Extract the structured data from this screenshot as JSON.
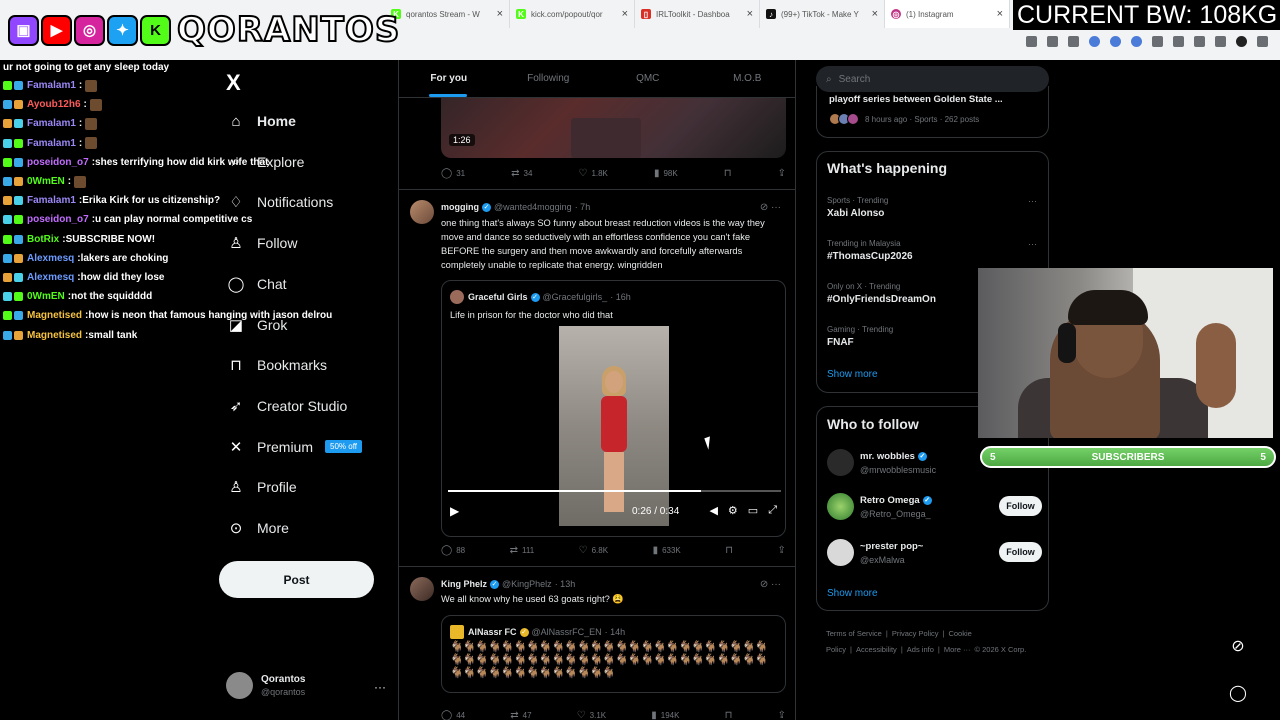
{
  "browser": {
    "tabs": [
      {
        "title": "qorantos Stream - W",
        "icon": "kick-icon",
        "color": "#53fc18"
      },
      {
        "title": "kick.com/popout/qor",
        "icon": "kick-icon",
        "color": "#53fc18"
      },
      {
        "title": "IRLToolkit - Dashboa",
        "icon": "irltoolkit-icon",
        "color": "#d93025"
      },
      {
        "title": "(99+) TikTok - Make Y",
        "icon": "tiktok-icon",
        "color": "#111111"
      },
      {
        "title": "(1) Instagram",
        "icon": "instagram-icon",
        "color": "#c13584"
      }
    ]
  },
  "overlay": {
    "streamer_name": "QORANTOS",
    "bandwidth": "CURRENT BW: 108KG",
    "social_icons": [
      "twitch-icon",
      "youtube-icon",
      "instagram-icon",
      "twitter-icon",
      "kick-icon"
    ],
    "subscribers": {
      "label": "SUBSCRIBERS",
      "current": "5",
      "goal": "5",
      "progress": 1.0
    }
  },
  "chat": {
    "first_line": "ur not going to get any sleep today",
    "messages": [
      {
        "user": "Famalam1",
        "text": "",
        "color": "#9b87f5",
        "emote": true
      },
      {
        "user": "Ayoub12h6",
        "text": "",
        "color": "#ff5a5a",
        "emote": true
      },
      {
        "user": "Famalam1",
        "text": "",
        "color": "#9b87f5",
        "emote": true
      },
      {
        "user": "Famalam1",
        "text": "",
        "color": "#9b87f5",
        "emote": true
      },
      {
        "user": "poseidon_o7",
        "text": "shes terrifying how did kirk wife that",
        "color": "#c26cff",
        "emote": false
      },
      {
        "user": "0WmEN",
        "text": "",
        "color": "#53fc18",
        "emote": true
      },
      {
        "user": "Famalam1",
        "text": "Erika Kirk for us citizenship?",
        "color": "#9b87f5",
        "emote": false
      },
      {
        "user": "poseidon_o7",
        "text": "u can play normal competitive cs",
        "color": "#c26cff",
        "emote": false
      },
      {
        "user": "BotRix",
        "text": "SUBSCRIBE NOW!",
        "color": "#53fc18",
        "emote": false
      },
      {
        "user": "Alexmesq",
        "text": "lakers are choking",
        "color": "#6c9bff",
        "emote": false
      },
      {
        "user": "Alexmesq",
        "text": "how did they lose",
        "color": "#6c9bff",
        "emote": false
      },
      {
        "user": "0WmEN",
        "text": "not the squidddd",
        "color": "#53fc18",
        "emote": false
      },
      {
        "user": "Magnetised",
        "text": "how is neon that famous hanging with jason delrou",
        "color": "#f5c242",
        "emote": false
      },
      {
        "user": "Magnetised",
        "text": "small tank",
        "color": "#f5c242",
        "emote": false
      }
    ]
  },
  "xnav": {
    "logo": "X",
    "items": [
      {
        "label": "Home",
        "icon": "home-icon",
        "glyph": "⌂"
      },
      {
        "label": "Explore",
        "icon": "explore-icon",
        "glyph": "⌕"
      },
      {
        "label": "Notifications",
        "icon": "bell-icon",
        "glyph": "♢"
      },
      {
        "label": "Follow",
        "icon": "follow-icon",
        "glyph": "♙"
      },
      {
        "label": "Chat",
        "icon": "chat-icon",
        "glyph": "◯"
      },
      {
        "label": "Grok",
        "icon": "grok-icon",
        "glyph": "◪"
      },
      {
        "label": "Bookmarks",
        "icon": "bookmark-icon",
        "glyph": "⊓"
      },
      {
        "label": "Creator Studio",
        "icon": "rocket-icon",
        "glyph": "➶"
      },
      {
        "label": "Premium",
        "icon": "x-premium-icon",
        "glyph": "✕"
      },
      {
        "label": "Profile",
        "icon": "profile-icon",
        "glyph": "♙"
      },
      {
        "label": "More",
        "icon": "more-icon",
        "glyph": "⊙"
      }
    ],
    "premium_badge": "50% off",
    "post_label": "Post",
    "account": {
      "name": "Qorantos",
      "handle": "@qorantos",
      "more": "···"
    }
  },
  "feed": {
    "tabs": [
      "For you",
      "Following",
      "QMC",
      "M.O.B"
    ],
    "post1": {
      "video_duration": "1:26",
      "stats": {
        "replies": "31",
        "reposts": "34",
        "likes": "1.8K",
        "views": "98K"
      }
    },
    "post2": {
      "display_name": "mogging",
      "handle": "@wanted4mogging",
      "time": "· 7h",
      "text": "one thing that's always SO funny about breast reduction videos is the way they move and dance so seductively with an effortless confidence you can't fake BEFORE the surgery and then move awkwardly and forcefully afterwards completely unable to replicate that energy. wingridden",
      "quote": {
        "display_name": "Graceful Girls",
        "handle": "@Gracefulgirls_",
        "time": "· 16h",
        "text": "Life in prison for the doctor who did that",
        "video_time": "0:26 / 0:34",
        "progress": 0.76
      },
      "stats": {
        "replies": "88",
        "reposts": "111",
        "likes": "6.8K",
        "views": "633K"
      }
    },
    "post3": {
      "display_name": "King Phelz",
      "handle": "@KingPhelz",
      "time": "· 13h",
      "text": "We all know why he used 63 goats right? 😩",
      "quote": {
        "display_name": "AlNassr FC",
        "handle": "@AlNassrFC_EN",
        "time": "· 14h",
        "goats": "🐐🐐🐐🐐🐐🐐🐐🐐🐐🐐🐐🐐🐐🐐🐐🐐🐐🐐🐐🐐🐐🐐🐐🐐🐐🐐🐐🐐🐐🐐🐐🐐🐐🐐🐐🐐🐐🐐🐐🐐🐐🐐🐐🐐🐐🐐🐐🐐🐐🐐🐐🐐🐐🐐🐐🐐🐐🐐🐐🐐🐐🐐🐐"
      },
      "stats": {
        "replies": "44",
        "reposts": "47",
        "likes": "3.1K",
        "views": "194K"
      }
    }
  },
  "right": {
    "search_placeholder": "Search",
    "top_trend": {
      "title": "playoff series between Golden State ...",
      "meta": "8 hours ago · Sports · 262 posts"
    },
    "happening_title": "What's happening",
    "trends": [
      {
        "context": "Sports · Trending",
        "name": "Xabi Alonso"
      },
      {
        "context": "Trending in Malaysia",
        "name": "#ThomasCup2026"
      },
      {
        "context": "Only on X · Trending",
        "name": "#OnlyFriendsDreamOn"
      },
      {
        "context": "Gaming · Trending",
        "name": "FNAF"
      }
    ],
    "show_more": "Show more",
    "who_title": "Who to follow",
    "who": [
      {
        "name": "mr. wobbles",
        "handle": "@mrwobblesmusic",
        "button": ""
      },
      {
        "name": "Retro Omega",
        "handle": "@Retro_Omega_",
        "button": "Follow"
      },
      {
        "name": "~prester pop~",
        "handle": "@exMalwa",
        "button": "Follow"
      }
    ],
    "footer": [
      "Terms of Service",
      "|",
      "Privacy Policy",
      "|",
      "Cookie Policy",
      "|",
      "Accessibility",
      "|",
      "Ads info",
      "|",
      "More ···",
      "© 2026 X Corp."
    ]
  }
}
